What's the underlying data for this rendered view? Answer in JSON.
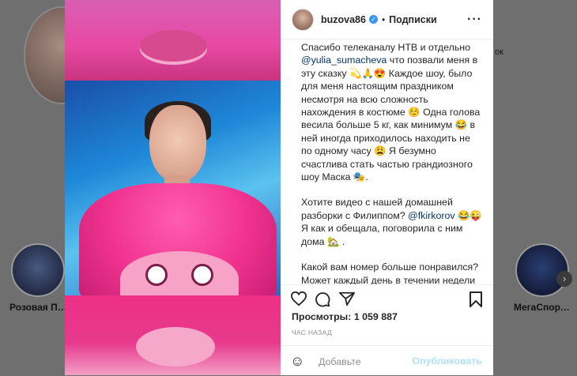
{
  "background": {
    "edge_text": "ок",
    "highlights": [
      {
        "label": "Розовая П…"
      },
      {
        "label": "МегаСпор…"
      }
    ],
    "next_icon": "chevron-right-icon"
  },
  "post": {
    "username": "buzova86",
    "separator": "•",
    "follow_label": "Подписки",
    "more_icon": "more-dots-icon",
    "caption": {
      "p1_a": "Спасибо телеканалу НТВ и отдельно ",
      "p1_mention": "@yulia_sumacheva",
      "p1_b": " что позвали меня в эту сказку 💫🙏😍 Каждое шоу, было для меня настоящим праздником несмотря на всю сложность нахождения в костюме ☺️ Одна голова весила больше 5 кг, как минимум 😂 в ней иногда приходилось находить не по одному часу 😩 Я безумно счастлива стать частью грандиозного шоу Маска 🎭.",
      "p2_a": "Хотите видео с нашей домашней разборки с Филиппом? ",
      "p2_mention": "@fkirkorov",
      "p2_b": " 😂😜 Я как и обещала, поговорила с ним дома 🏡 .",
      "p3": "Какой вам номер больше понравился? Может каждый день в течении недели выкладывать сюда по номеру? 😍"
    },
    "views_label": "Просмотры: 1 059 887",
    "time_label": "ЧАС НАЗАД",
    "comment_placeholder": "Добавьте",
    "publish_label": "Опубликовать"
  },
  "colors": {
    "link": "#003569",
    "verified": "#3897f0",
    "publish_disabled": "#b2dffc",
    "muted": "#8e8e8e"
  }
}
